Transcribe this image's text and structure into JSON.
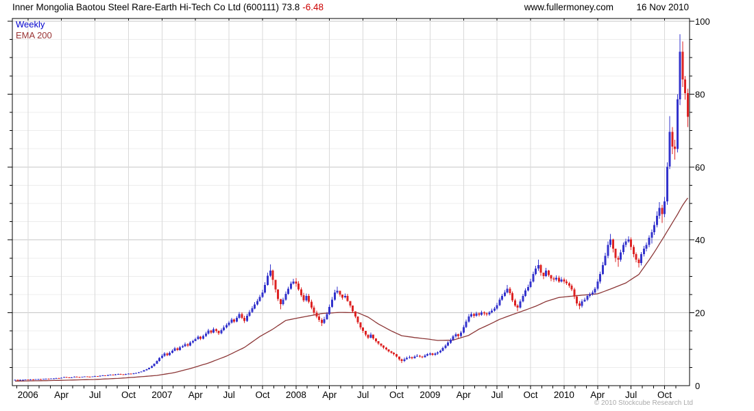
{
  "header": {
    "title": "Inner Mongolia Baotou Steel Rare-Earth Hi-Tech Co Ltd (600111)",
    "last_price": "73.8",
    "change": "-6.48",
    "website": "www.fullermoney.com",
    "date": "16 Nov 2010"
  },
  "legend": {
    "weekly_label": "Weekly",
    "ema_label": "EMA 200"
  },
  "footer": {
    "copyright": "© 2010 Stockcube Research Ltd"
  },
  "chart_data": {
    "type": "candlestick",
    "timeframe": "weekly",
    "title": "Inner Mongolia Baotou Steel Rare-Earth Hi-Tech Co Ltd (600111)",
    "last_close": 73.8,
    "change": -6.48,
    "y_axis": {
      "min": 0,
      "max": 101,
      "major_tick_labels": [
        0,
        20,
        40,
        60,
        80,
        100
      ],
      "minor_step": 5,
      "labels_side": "right"
    },
    "x_axis": {
      "start": "Dec 2005",
      "end": "Nov 2010",
      "tick_labels": [
        "2006",
        "Apr",
        "Jul",
        "Oct",
        "2007",
        "Apr",
        "Jul",
        "Oct",
        "2008",
        "Apr",
        "Jul",
        "Oct",
        "2009",
        "Apr",
        "Jul",
        "Oct",
        "2010",
        "Apr",
        "Jul",
        "Oct"
      ],
      "tick_week_indices": [
        5,
        18,
        31,
        44,
        57,
        70,
        83,
        96,
        109,
        122,
        135,
        148,
        161,
        174,
        187,
        200,
        213,
        226,
        239,
        252
      ]
    },
    "colors": {
      "up_candle": "#3333cc",
      "down_candle": "#dd2222",
      "ema_line": "#8b3535",
      "grid_minor": "#ececec",
      "grid_major": "#c6c6c6",
      "grid_vertical": "#d9d9d9",
      "axis": "#000000",
      "title_change": "#cc0000",
      "legend_weekly": "#0000cc",
      "legend_ema": "#993333"
    },
    "grid": {
      "horizontal_every": 5,
      "horizontal_major_every": 20,
      "vertical": "quarterly"
    },
    "legend_position": "top-left",
    "open_rule": "previous_close",
    "weeks": {
      "close": [
        1.6,
        1.55,
        1.6,
        1.6,
        1.65,
        1.6,
        1.7,
        1.65,
        1.75,
        1.8,
        1.75,
        1.85,
        1.9,
        1.85,
        1.95,
        2.0,
        2.1,
        2.05,
        2.2,
        2.35,
        2.25,
        2.15,
        2.3,
        2.45,
        2.35,
        2.3,
        2.4,
        2.5,
        2.45,
        2.4,
        2.5,
        2.6,
        2.55,
        2.7,
        2.8,
        2.7,
        2.9,
        3.0,
        2.9,
        3.1,
        3.2,
        3.1,
        3.0,
        3.2,
        3.3,
        3.2,
        3.4,
        3.5,
        3.7,
        3.9,
        4.2,
        4.5,
        4.9,
        5.4,
        6.0,
        6.8,
        7.6,
        8.2,
        8.8,
        8.4,
        9.0,
        9.6,
        10.2,
        9.8,
        10.5,
        10.8,
        11.4,
        11.0,
        11.8,
        12.2,
        12.8,
        13.4,
        12.9,
        13.6,
        14.3,
        15.1,
        14.6,
        15.5,
        15.0,
        14.4,
        15.2,
        16.0,
        16.6,
        17.3,
        18.1,
        17.6,
        18.6,
        19.6,
        18.6,
        17.8,
        19.2,
        20.2,
        21.2,
        22.3,
        23.2,
        24.3,
        25.6,
        27.6,
        30.2,
        31.6,
        29.0,
        26.4,
        23.8,
        22.4,
        23.6,
        25.2,
        26.6,
        28.0,
        28.6,
        28.0,
        26.4,
        24.8,
        23.4,
        24.6,
        23.0,
        21.4,
        20.0,
        19.0,
        18.0,
        17.2,
        18.2,
        19.6,
        21.6,
        23.6,
        25.6,
        26.0,
        25.0,
        24.2,
        24.6,
        23.2,
        22.0,
        20.4,
        19.0,
        17.4,
        16.0,
        15.0,
        14.0,
        13.2,
        14.0,
        13.0,
        12.2,
        11.6,
        11.0,
        10.4,
        10.0,
        9.4,
        9.0,
        8.6,
        8.0,
        7.2,
        6.8,
        7.2,
        7.6,
        7.8,
        7.5,
        8.0,
        8.2,
        8.0,
        7.8,
        8.3,
        8.6,
        8.8,
        8.5,
        8.8,
        9.1,
        9.6,
        10.3,
        11.0,
        11.8,
        12.6,
        13.5,
        14.1,
        13.6,
        14.6,
        16.1,
        17.6,
        19.0,
        19.6,
        19.2,
        19.8,
        19.5,
        20.1,
        19.8,
        19.6,
        20.1,
        20.6,
        21.1,
        22.1,
        23.6,
        24.6,
        25.6,
        26.6,
        25.4,
        23.4,
        22.0,
        21.4,
        23.1,
        24.6,
        26.1,
        27.1,
        28.6,
        30.6,
        32.1,
        33.1,
        31.0,
        30.1,
        31.6,
        30.4,
        29.4,
        29.1,
        29.6,
        28.6,
        29.1,
        28.6,
        28.1,
        27.4,
        26.4,
        24.4,
        22.6,
        21.9,
        23.1,
        23.6,
        24.6,
        25.1,
        25.6,
        26.6,
        28.6,
        30.6,
        33.1,
        35.6,
        38.6,
        40.1,
        37.6,
        35.1,
        34.6,
        36.6,
        38.6,
        39.6,
        40.1,
        38.1,
        36.1,
        34.6,
        33.6,
        36.1,
        37.6,
        38.6,
        40.6,
        42.1,
        44.1,
        46.6,
        48.8,
        47.1,
        50.6,
        60.1,
        69.6,
        65.6,
        64.9,
        78.6,
        91.6,
        84.0,
        80.3,
        73.8
      ],
      "high": [
        1.65,
        1.65,
        1.65,
        1.67,
        1.7,
        1.72,
        1.78,
        1.76,
        1.83,
        1.88,
        1.86,
        1.92,
        1.97,
        1.96,
        2.02,
        2.08,
        2.18,
        2.16,
        2.28,
        2.43,
        2.42,
        2.32,
        2.38,
        2.53,
        2.52,
        2.44,
        2.48,
        2.58,
        2.56,
        2.52,
        2.58,
        2.68,
        2.67,
        2.78,
        2.88,
        2.86,
        2.98,
        3.08,
        3.07,
        3.18,
        3.28,
        3.27,
        3.17,
        3.28,
        3.38,
        3.37,
        3.48,
        3.58,
        3.78,
        3.98,
        4.3,
        4.6,
        5.0,
        5.5,
        6.15,
        7.0,
        7.8,
        8.6,
        9.2,
        9.1,
        9.4,
        10.0,
        10.6,
        10.5,
        10.9,
        11.2,
        11.8,
        11.7,
        12.2,
        12.6,
        13.2,
        13.8,
        13.6,
        14.0,
        14.8,
        15.6,
        15.3,
        16.0,
        15.7,
        15.1,
        15.7,
        16.5,
        17.1,
        17.8,
        18.6,
        18.4,
        19.1,
        20.2,
        20.1,
        19.2,
        19.7,
        20.8,
        21.8,
        22.9,
        23.8,
        24.9,
        26.3,
        28.4,
        31.0,
        33.3,
        31.9,
        28.0,
        25.2,
        23.6,
        24.2,
        25.8,
        27.2,
        28.6,
        29.3,
        29.5,
        28.7,
        27.0,
        25.5,
        25.3,
        25.2,
        23.6,
        22.0,
        20.6,
        19.6,
        18.5,
        18.9,
        20.2,
        22.3,
        24.3,
        26.3,
        27.2,
        25.8,
        25.0,
        25.3,
        25.2,
        22.8,
        21.0,
        19.7,
        18.0,
        16.7,
        15.6,
        14.6,
        13.9,
        14.6,
        13.6,
        12.8,
        12.2,
        11.6,
        11.1,
        10.6,
        10.0,
        9.6,
        9.2,
        8.7,
        7.9,
        7.4,
        7.7,
        8.0,
        8.3,
        8.0,
        8.4,
        8.6,
        8.5,
        8.2,
        8.6,
        8.9,
        9.1,
        9.0,
        9.1,
        9.4,
        9.9,
        10.7,
        11.4,
        12.2,
        13.0,
        13.9,
        14.6,
        14.3,
        15.0,
        16.6,
        18.1,
        19.6,
        20.2,
        19.9,
        20.3,
        20.1,
        20.6,
        20.4,
        20.1,
        20.5,
        21.1,
        21.6,
        22.7,
        24.2,
        25.2,
        26.2,
        27.6,
        27.1,
        25.8,
        23.9,
        22.4,
        23.7,
        25.2,
        26.7,
        27.7,
        29.3,
        31.3,
        32.9,
        34.6,
        33.4,
        31.0,
        32.3,
        31.8,
        30.4,
        29.9,
        30.3,
        30.2,
        29.8,
        29.6,
        29.1,
        28.5,
        27.9,
        26.9,
        24.9,
        23.2,
        23.7,
        24.2,
        25.1,
        25.6,
        26.1,
        27.1,
        29.2,
        31.3,
        33.9,
        36.5,
        39.6,
        41.6,
        40.3,
        36.3,
        35.6,
        37.3,
        39.3,
        40.3,
        41.0,
        40.7,
        38.6,
        36.6,
        35.1,
        36.7,
        38.3,
        39.3,
        41.3,
        42.9,
        45.0,
        47.8,
        50.4,
        49.6,
        51.8,
        61.3,
        74.0,
        71.0,
        67.5,
        80.0,
        96.4,
        94.5,
        85.0,
        81.5
      ],
      "low": [
        1.52,
        1.5,
        1.52,
        1.55,
        1.56,
        1.52,
        1.55,
        1.57,
        1.58,
        1.67,
        1.67,
        1.68,
        1.77,
        1.77,
        1.78,
        1.87,
        1.92,
        1.97,
        1.97,
        2.12,
        2.17,
        2.07,
        2.07,
        2.22,
        2.27,
        2.22,
        2.22,
        2.32,
        2.37,
        2.32,
        2.32,
        2.42,
        2.47,
        2.47,
        2.62,
        2.62,
        2.62,
        2.82,
        2.82,
        2.82,
        3.02,
        3.02,
        2.92,
        2.92,
        3.12,
        3.12,
        3.12,
        3.32,
        3.42,
        3.62,
        3.82,
        4.12,
        4.42,
        4.8,
        5.3,
        5.9,
        6.6,
        7.4,
        7.9,
        8.1,
        8.2,
        8.8,
        9.4,
        9.5,
        9.6,
        10.3,
        10.6,
        10.6,
        10.8,
        11.6,
        12.3,
        12.6,
        12.5,
        12.7,
        13.3,
        14.0,
        14.2,
        14.4,
        14.6,
        13.9,
        14.1,
        14.9,
        15.7,
        16.3,
        17.0,
        17.2,
        17.4,
        18.3,
        18.2,
        17.2,
        17.5,
        18.9,
        19.9,
        21.0,
        22.0,
        23.0,
        24.1,
        25.3,
        27.4,
        29.8,
        27.5,
        25.6,
        23.2,
        21.0,
        22.0,
        23.3,
        24.9,
        26.3,
        27.7,
        27.2,
        26.0,
        24.3,
        22.9,
        23.0,
        22.6,
        21.0,
        19.5,
        18.5,
        17.5,
        16.4,
        16.9,
        18.0,
        19.4,
        21.3,
        23.3,
        25.2,
        24.4,
        23.6,
        24.0,
        23.0,
        21.4,
        19.9,
        18.5,
        16.9,
        15.4,
        14.5,
        13.5,
        12.8,
        13.0,
        12.6,
        11.8,
        11.2,
        10.6,
        10.1,
        9.7,
        9.1,
        8.7,
        8.3,
        7.7,
        6.9,
        6.2,
        6.5,
        7.1,
        7.4,
        7.2,
        7.4,
        7.9,
        7.7,
        7.5,
        7.7,
        8.1,
        8.3,
        8.2,
        8.2,
        8.5,
        8.9,
        9.4,
        10.1,
        10.8,
        11.5,
        12.3,
        13.2,
        13.1,
        13.3,
        14.3,
        15.8,
        17.3,
        18.7,
        18.6,
        18.9,
        19.0,
        19.2,
        19.3,
        19.1,
        19.2,
        19.8,
        20.3,
        20.8,
        21.8,
        23.3,
        24.3,
        25.3,
        24.8,
        22.9,
        21.6,
        20.4,
        21.1,
        22.8,
        24.3,
        25.8,
        26.8,
        28.3,
        30.3,
        31.5,
        30.2,
        29.2,
        29.8,
        29.9,
        28.7,
        28.5,
        28.7,
        28.2,
        28.3,
        28.0,
        27.6,
        26.9,
        25.9,
        23.8,
        21.9,
        21.0,
        21.4,
        22.9,
        23.2,
        24.2,
        24.7,
        25.1,
        26.1,
        28.0,
        30.4,
        32.9,
        35.0,
        38.0,
        36.6,
        33.9,
        32.6,
        34.0,
        36.0,
        38.0,
        39.2,
        37.2,
        35.2,
        33.8,
        32.4,
        33.0,
        35.4,
        36.8,
        38.0,
        39.0,
        41.4,
        43.4,
        45.8,
        44.6,
        46.2,
        49.6,
        59.4,
        63.5,
        62.0,
        64.0,
        77.0,
        82.0,
        78.5,
        71.0
      ]
    },
    "ema200_anchors": [
      [
        0,
        1.25
      ],
      [
        10,
        1.35
      ],
      [
        20,
        1.5
      ],
      [
        31,
        1.7
      ],
      [
        40,
        2.0
      ],
      [
        48,
        2.4
      ],
      [
        55,
        2.8
      ],
      [
        62,
        3.6
      ],
      [
        68,
        4.7
      ],
      [
        75,
        6.2
      ],
      [
        82,
        8.1
      ],
      [
        89,
        10.5
      ],
      [
        95,
        13.5
      ],
      [
        100,
        15.5
      ],
      [
        105,
        17.9
      ],
      [
        110,
        18.6
      ],
      [
        119,
        19.8
      ],
      [
        126,
        20.1
      ],
      [
        133,
        20.0
      ],
      [
        137,
        18.8
      ],
      [
        141,
        16.9
      ],
      [
        146,
        15.0
      ],
      [
        150,
        13.7
      ],
      [
        155,
        13.2
      ],
      [
        160,
        12.8
      ],
      [
        164,
        12.4
      ],
      [
        170,
        12.5
      ],
      [
        176,
        13.8
      ],
      [
        180,
        15.5
      ],
      [
        184,
        16.8
      ],
      [
        188,
        18.2
      ],
      [
        193,
        19.5
      ],
      [
        197,
        20.5
      ],
      [
        202,
        21.8
      ],
      [
        206,
        23.1
      ],
      [
        211,
        24.2
      ],
      [
        218,
        24.7
      ],
      [
        226,
        25.2
      ],
      [
        231,
        26.5
      ],
      [
        237,
        28.2
      ],
      [
        242,
        30.5
      ],
      [
        246,
        34.5
      ],
      [
        248,
        36.6
      ],
      [
        251,
        40.0
      ],
      [
        254,
        43.5
      ],
      [
        257,
        47.0
      ],
      [
        259,
        49.5
      ],
      [
        261,
        51.5
      ]
    ]
  }
}
